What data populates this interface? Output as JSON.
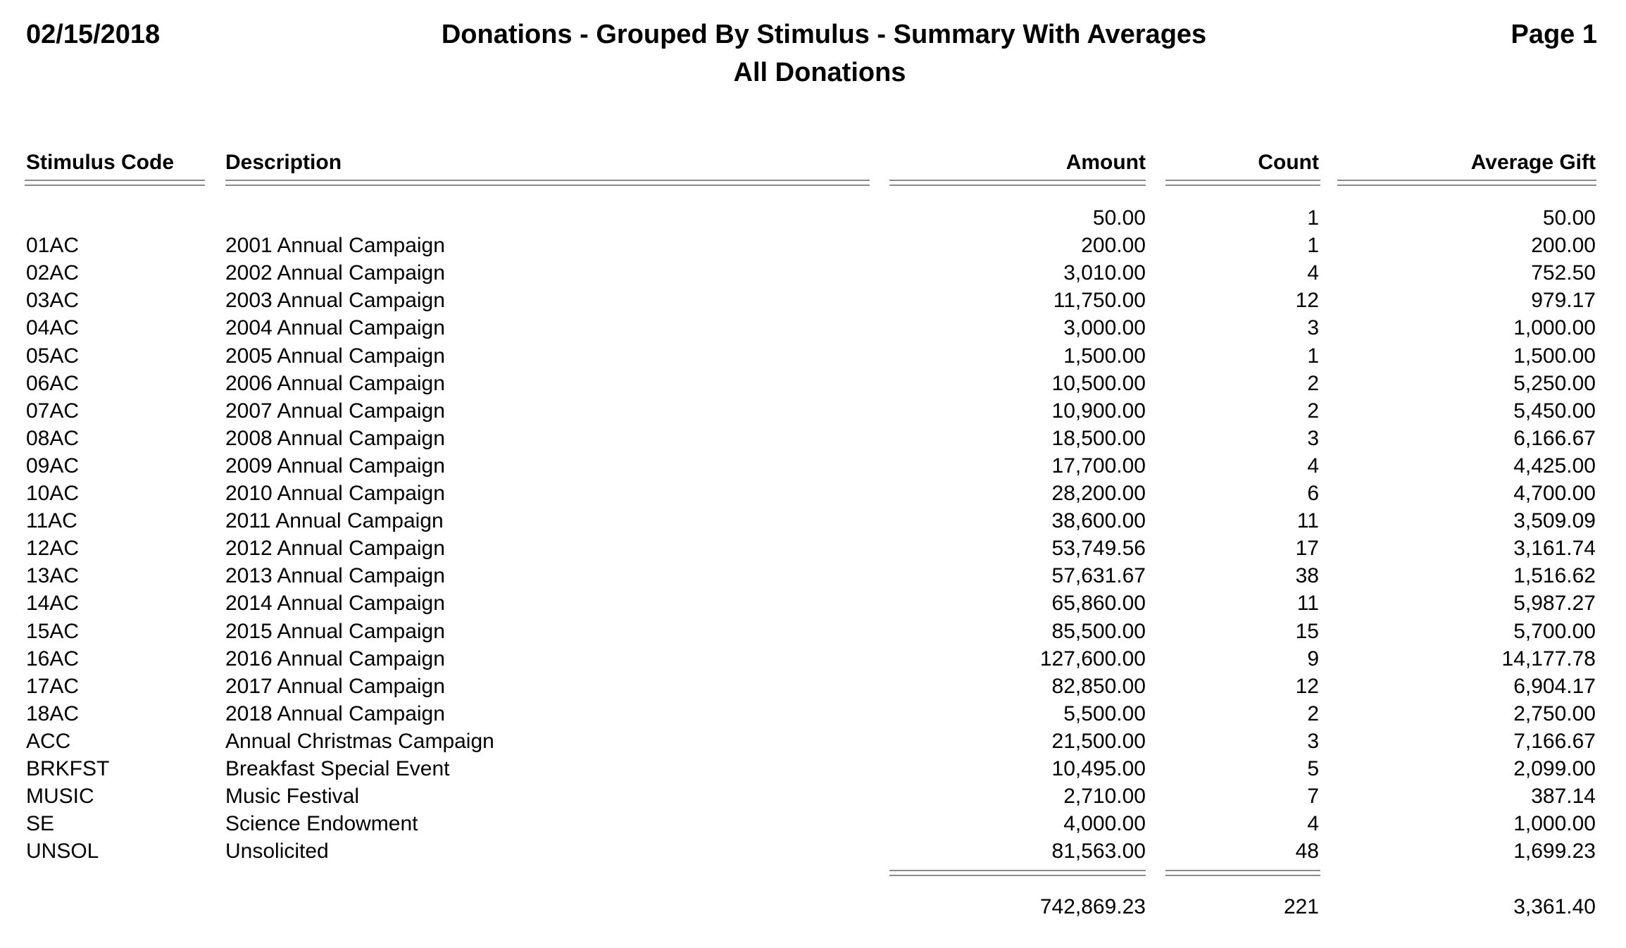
{
  "report": {
    "date": "02/15/2018",
    "title": "Donations - Grouped By Stimulus - Summary With Averages",
    "subtitle": "All Donations",
    "page": "Page 1"
  },
  "columns": {
    "code": "Stimulus Code",
    "description": "Description",
    "amount": "Amount",
    "count": "Count",
    "average": "Average Gift"
  },
  "rows": [
    {
      "code": "",
      "description": "",
      "amount": "50.00",
      "count": "1",
      "average": "50.00"
    },
    {
      "code": "01AC",
      "description": "2001 Annual Campaign",
      "amount": "200.00",
      "count": "1",
      "average": "200.00"
    },
    {
      "code": "02AC",
      "description": "2002 Annual Campaign",
      "amount": "3,010.00",
      "count": "4",
      "average": "752.50"
    },
    {
      "code": "03AC",
      "description": "2003 Annual Campaign",
      "amount": "11,750.00",
      "count": "12",
      "average": "979.17"
    },
    {
      "code": "04AC",
      "description": "2004 Annual Campaign",
      "amount": "3,000.00",
      "count": "3",
      "average": "1,000.00"
    },
    {
      "code": "05AC",
      "description": "2005 Annual Campaign",
      "amount": "1,500.00",
      "count": "1",
      "average": "1,500.00"
    },
    {
      "code": "06AC",
      "description": "2006 Annual Campaign",
      "amount": "10,500.00",
      "count": "2",
      "average": "5,250.00"
    },
    {
      "code": "07AC",
      "description": "2007 Annual Campaign",
      "amount": "10,900.00",
      "count": "2",
      "average": "5,450.00"
    },
    {
      "code": "08AC",
      "description": "2008 Annual Campaign",
      "amount": "18,500.00",
      "count": "3",
      "average": "6,166.67"
    },
    {
      "code": "09AC",
      "description": "2009 Annual Campaign",
      "amount": "17,700.00",
      "count": "4",
      "average": "4,425.00"
    },
    {
      "code": "10AC",
      "description": "2010 Annual Campaign",
      "amount": "28,200.00",
      "count": "6",
      "average": "4,700.00"
    },
    {
      "code": "11AC",
      "description": "2011 Annual Campaign",
      "amount": "38,600.00",
      "count": "11",
      "average": "3,509.09"
    },
    {
      "code": "12AC",
      "description": "2012 Annual Campaign",
      "amount": "53,749.56",
      "count": "17",
      "average": "3,161.74"
    },
    {
      "code": "13AC",
      "description": "2013 Annual Campaign",
      "amount": "57,631.67",
      "count": "38",
      "average": "1,516.62"
    },
    {
      "code": "14AC",
      "description": "2014 Annual Campaign",
      "amount": "65,860.00",
      "count": "11",
      "average": "5,987.27"
    },
    {
      "code": "15AC",
      "description": "2015 Annual Campaign",
      "amount": "85,500.00",
      "count": "15",
      "average": "5,700.00"
    },
    {
      "code": "16AC",
      "description": "2016 Annual Campaign",
      "amount": "127,600.00",
      "count": "9",
      "average": "14,177.78"
    },
    {
      "code": "17AC",
      "description": "2017 Annual Campaign",
      "amount": "82,850.00",
      "count": "12",
      "average": "6,904.17"
    },
    {
      "code": "18AC",
      "description": "2018 Annual Campaign",
      "amount": "5,500.00",
      "count": "2",
      "average": "2,750.00"
    },
    {
      "code": "ACC",
      "description": "Annual Christmas Campaign",
      "amount": "21,500.00",
      "count": "3",
      "average": "7,166.67"
    },
    {
      "code": "BRKFST",
      "description": "Breakfast Special Event",
      "amount": "10,495.00",
      "count": "5",
      "average": "2,099.00"
    },
    {
      "code": "MUSIC",
      "description": "Music Festival",
      "amount": "2,710.00",
      "count": "7",
      "average": "387.14"
    },
    {
      "code": "SE",
      "description": "Science Endowment",
      "amount": "4,000.00",
      "count": "4",
      "average": "1,000.00"
    },
    {
      "code": "UNSOL",
      "description": "Unsolicited",
      "amount": "81,563.00",
      "count": "48",
      "average": "1,699.23"
    }
  ],
  "totals": {
    "amount": "742,869.23",
    "count": "221",
    "average": "3,361.40"
  }
}
